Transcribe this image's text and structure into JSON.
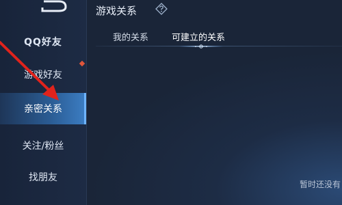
{
  "header": {
    "title": "游戏关系",
    "help_icon": "question-diamond-icon"
  },
  "sidebar": {
    "back_icon": "back-arrow-icon",
    "items": [
      {
        "label": "QQ好友"
      },
      {
        "label": "游戏好友",
        "badge": "red-dot"
      },
      {
        "label": "亲密关系",
        "active": true
      },
      {
        "label": "关注/粉丝"
      },
      {
        "label": "找朋友"
      }
    ]
  },
  "tabs": [
    {
      "label": "我的关系"
    },
    {
      "label": "可建立的关系",
      "active": true
    }
  ],
  "main": {
    "empty_text": "暂时还没有"
  },
  "colors": {
    "accent": "#6fb4ff",
    "annotation_arrow": "#e0231c",
    "badge": "#e0563a"
  }
}
